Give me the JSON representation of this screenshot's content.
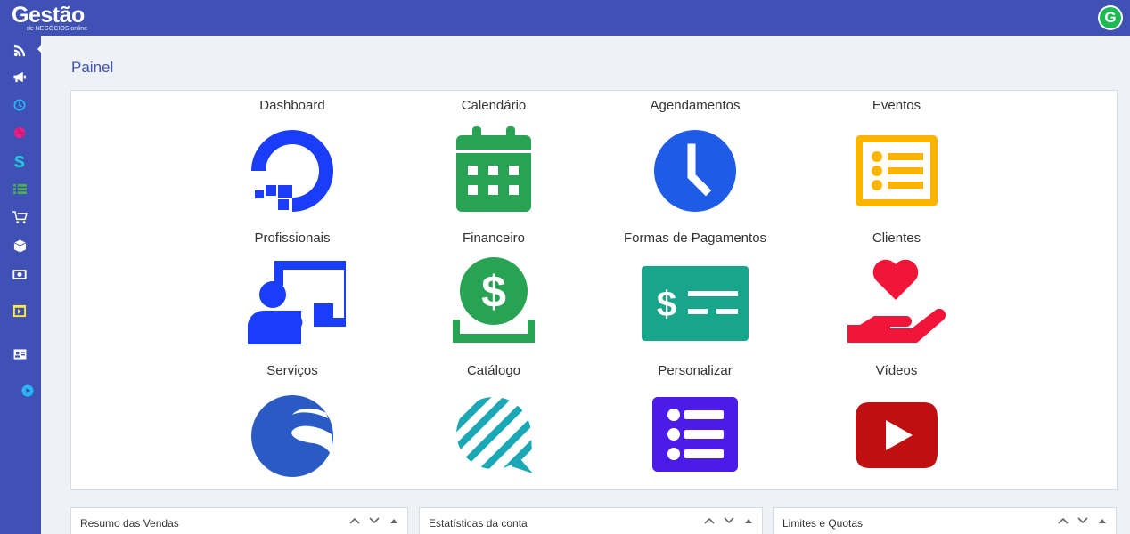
{
  "brand": {
    "name": "Gestão",
    "tagline": "de NEGÓCIOS online",
    "avatar_letter": "G"
  },
  "sidebar": {
    "items": [
      {
        "name": "rss-icon",
        "color": "#ffffff"
      },
      {
        "name": "megaphone-icon",
        "color": "#ffffff"
      },
      {
        "name": "clock-icon",
        "color": "#29b6f6"
      },
      {
        "name": "dribbble-icon",
        "color": "#e91e8c"
      },
      {
        "name": "shopware-icon",
        "color": "#26c6da"
      },
      {
        "name": "list-icon",
        "color": "#4caf50"
      },
      {
        "name": "cart-icon",
        "color": "#ffffff"
      },
      {
        "name": "box-icon",
        "color": "#ffffff"
      },
      {
        "name": "money-icon",
        "color": "#ffffff"
      },
      {
        "name": "video-slides-icon",
        "color": "#ffeb3b"
      },
      {
        "name": "id-card-icon",
        "color": "#ffffff"
      },
      {
        "name": "play-circle-icon",
        "color": "#29b6f6"
      }
    ]
  },
  "page": {
    "title": "Painel"
  },
  "tiles": [
    {
      "label": "Dashboard",
      "icon": "digitalocean-icon",
      "color": "#1a3dfa"
    },
    {
      "label": "Calendário",
      "icon": "calendar-icon",
      "color": "#27a353"
    },
    {
      "label": "Agendamentos",
      "icon": "clock-icon",
      "color": "#1e5be6"
    },
    {
      "label": "Eventos",
      "icon": "list-alt-icon",
      "color": "#fdb400"
    },
    {
      "label": "Profissionais",
      "icon": "teacher-icon",
      "color": "#1a3dfa"
    },
    {
      "label": "Financeiro",
      "icon": "money-bag-icon",
      "color": "#27a353"
    },
    {
      "label": "Formas de Pagamentos",
      "icon": "money-check-icon",
      "color": "#17a58b"
    },
    {
      "label": "Clientes",
      "icon": "hand-heart-icon",
      "color": "#f2153a"
    },
    {
      "label": "Serviços",
      "icon": "shopware-icon",
      "color": "#2a5bc4"
    },
    {
      "label": "Catálogo",
      "icon": "stream-bubble-icon",
      "color": "#1ba8b5"
    },
    {
      "label": "Personalizar",
      "icon": "list-square-icon",
      "color": "#4c1be8"
    },
    {
      "label": "Vídeos",
      "icon": "youtube-icon",
      "color": "#c00f10"
    }
  ],
  "widgets": [
    {
      "title": "Resumo das Vendas"
    },
    {
      "title": "Estatísticas da conta"
    },
    {
      "title": "Limites e Quotas"
    }
  ],
  "colors": {
    "topbar": "#3f51b5",
    "background": "#eef2f7",
    "title": "#3f51b5"
  }
}
